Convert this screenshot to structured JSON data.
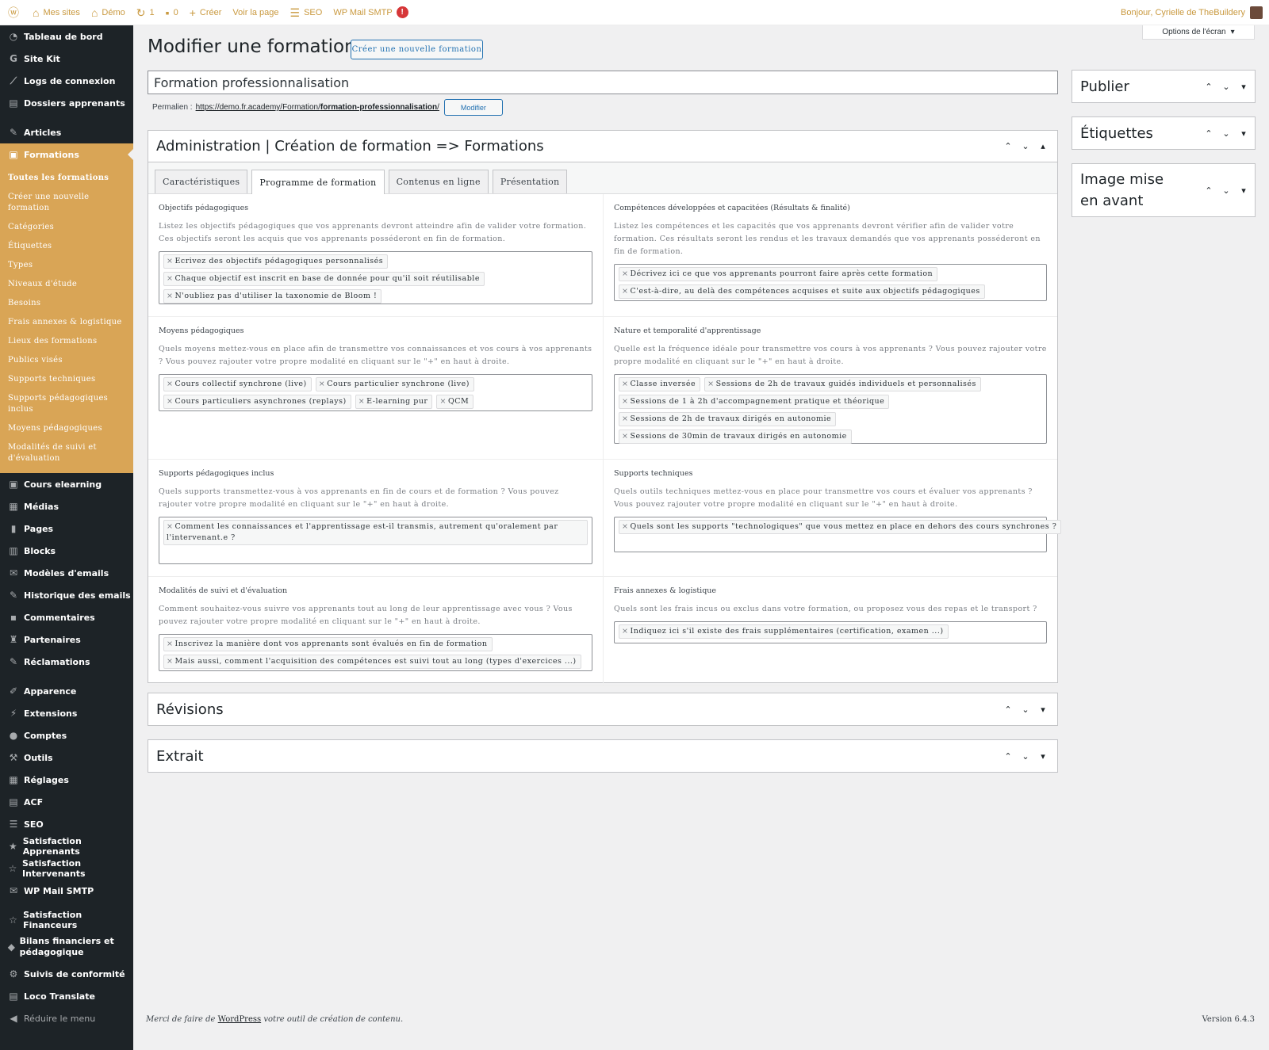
{
  "adminbar": {
    "my_sites": "Mes sites",
    "site_name": "Démo",
    "updates_count": "1",
    "comments_count": "0",
    "new_label": "Créer",
    "view_page": "Voir la page",
    "seo": "SEO",
    "smtp": "WP Mail SMTP",
    "smtp_badge": "!",
    "greeting": "Bonjour, Cyrielle de TheBuildery"
  },
  "sidebar": {
    "top_items": [
      {
        "label": "Tableau de bord",
        "icon": "dashboard-icon"
      },
      {
        "label": "Site Kit",
        "icon": "google-icon"
      },
      {
        "label": "Logs de connexion",
        "icon": "chart-icon"
      },
      {
        "label": "Dossiers apprenants",
        "icon": "folder-icon"
      }
    ],
    "articles": "Articles",
    "formations": "Formations",
    "submenu": [
      "Toutes les formations",
      "Créer une nouvelle formation",
      "Catégories",
      "Étiquettes",
      "Types",
      "Niveaux d'étude",
      "Besoins",
      "Frais annexes & logistique",
      "Lieux des formations",
      "Publics visés",
      "Supports techniques",
      "Supports pédagogiques inclus",
      "Moyens pédagogiques",
      "Modalités de suivi et d'évaluation"
    ],
    "items_after": [
      {
        "label": "Cours elearning",
        "icon": "course-icon"
      },
      {
        "label": "Médias",
        "icon": "media-icon"
      },
      {
        "label": "Pages",
        "icon": "pages-icon"
      },
      {
        "label": "Blocks",
        "icon": "blocks-icon"
      },
      {
        "label": "Modèles d'emails",
        "icon": "email-icon"
      },
      {
        "label": "Historique des emails",
        "icon": "history-icon"
      },
      {
        "label": "Commentaires",
        "icon": "comments-icon"
      },
      {
        "label": "Partenaires",
        "icon": "partners-icon"
      },
      {
        "label": "Réclamations",
        "icon": "claims-icon"
      }
    ],
    "items_admin": [
      {
        "label": "Apparence",
        "icon": "appearance-icon"
      },
      {
        "label": "Extensions",
        "icon": "plugins-icon"
      },
      {
        "label": "Comptes",
        "icon": "users-icon"
      },
      {
        "label": "Outils",
        "icon": "tools-icon"
      },
      {
        "label": "Réglages",
        "icon": "settings-icon"
      },
      {
        "label": "ACF",
        "icon": "acf-icon"
      },
      {
        "label": "SEO",
        "icon": "seo-icon"
      },
      {
        "label": "Satisfaction Apprenants",
        "icon": "star-icon"
      },
      {
        "label": "Satisfaction Intervenants",
        "icon": "star-outline-icon"
      },
      {
        "label": "WP Mail SMTP",
        "icon": "mail-icon"
      }
    ],
    "items_bottom": [
      {
        "label": "Satisfaction Financeurs",
        "icon": "star-outline-icon"
      },
      {
        "label": "Bilans financiers et pédagogique",
        "icon": "tag-icon"
      },
      {
        "label": "Suivis de conformité",
        "icon": "compliance-icon"
      },
      {
        "label": "Loco Translate",
        "icon": "translate-icon"
      }
    ],
    "collapse": "Réduire le menu"
  },
  "page": {
    "screen_options": "Options de l'écran",
    "title": "Modifier une formation",
    "add_new": "Créer une nouvelle formation",
    "post_title": "Formation professionnalisation",
    "permalink_label": "Permalien :",
    "permalink_base": "https://demo.fr.academy/Formation/",
    "permalink_slug": "formation-professionnalisation",
    "permalink_end": "/",
    "permalink_edit": "Modifier"
  },
  "acf": {
    "title": "Administration | Création de formation => Formations",
    "tabs": [
      "Caractéristiques",
      "Programme de formation",
      "Contenus en ligne",
      "Présentation"
    ],
    "fields": [
      {
        "label": "Objectifs pédagogiques",
        "desc": "Listez les objectifs pédagogiques que vos apprenants devront atteindre afin de valider votre formation. Ces objectifs seront les acquis que vos apprenants posséderont en fin de formation.",
        "chips": [
          "Ecrivez des objectifs pédagogiques personnalisés",
          "Chaque objectif est inscrit en base de donnée pour qu'il soit réutilisable",
          "N'oubliez pas d'utiliser la taxonomie de Bloom !"
        ]
      },
      {
        "label": "Compétences développées et capacitées (Résultats & finalité)",
        "desc": "Listez les compétences et les capacités que vos apprenants devront vérifier afin de valider votre formation. Ces résultats seront les rendus et les travaux demandés que vos apprenants posséderont en fin de formation.",
        "chips": [
          "Décrivez ici ce que vos apprenants pourront faire après cette formation",
          "C'est-à-dire, au delà des compétences acquises et suite aux objectifs pédagogiques"
        ]
      },
      {
        "label": "Moyens pédagogiques",
        "desc": "Quels moyens mettez-vous en place afin de transmettre vos connaissances et vos cours à vos apprenants ? Vous pouvez rajouter votre propre modalité en cliquant sur le \"+\" en haut à droite.",
        "chips": [
          "Cours collectif synchrone (live)",
          "Cours particulier synchrone (live)",
          "Cours particuliers asynchrones (replays)",
          "E-learning pur",
          "QCM"
        ]
      },
      {
        "label": "Nature et temporalité d'apprentissage",
        "desc": "Quelle est la fréquence idéale pour transmettre vos cours à vos apprenants ? Vous pouvez rajouter votre propre modalité en cliquant sur le \"+\" en haut à droite.",
        "chips": [
          "Classe inversée",
          "Sessions de 2h de travaux guidés individuels et personnalisés",
          "Sessions de 1 à 2h d'accompagnement pratique et théorique",
          "Sessions de 2h de travaux dirigés en autonomie",
          "Sessions de 30min de travaux dirigés en autonomie"
        ]
      },
      {
        "label": "Supports pédagogiques inclus",
        "desc": "Quels supports transmettez-vous à vos apprenants en fin de cours et de formation ? Vous pouvez rajouter votre propre modalité en cliquant sur le \"+\" en haut à droite.",
        "chips": [
          "Comment les connaissances et l'apprentissage est-il transmis, autrement qu'oralement par l'intervenant.e ?"
        ]
      },
      {
        "label": "Supports techniques",
        "desc": "Quels outils techniques mettez-vous en place pour transmettre vos cours et évaluer vos apprenants ? Vous pouvez rajouter votre propre modalité en cliquant sur le \"+\" en haut à droite.",
        "chips": [
          "Quels sont les supports \"technologiques\" que vous mettez en place en dehors des cours synchrones ?"
        ]
      },
      {
        "label": "Modalités de suivi et d'évaluation",
        "desc": "Comment souhaitez-vous suivre vos apprenants tout au long de leur apprentissage avec vous ? Vous pouvez rajouter votre propre modalité en cliquant sur le \"+\" en haut à droite.",
        "chips": [
          "Inscrivez la manière dont vos apprenants sont évalués en fin de formation",
          "Mais aussi, comment l'acquisition des compétences est suivi tout au long (types d'exercices ...)"
        ]
      },
      {
        "label": "Frais annexes & logistique",
        "desc": "Quels sont les frais incus ou exclus dans votre formation, ou proposez vous des repas et le transport ?",
        "chips": [
          "Indiquez ici s'il existe des frais supplémentaires (certification, examen ...)"
        ]
      }
    ]
  },
  "boxes": {
    "revisions": "Révisions",
    "excerpt": "Extrait",
    "publish": "Publier",
    "tags": "Étiquettes",
    "featured": "Image mise en avant"
  },
  "footer": {
    "thanks_pre": "Merci de faire de ",
    "thanks_link": "WordPress",
    "thanks_post": " votre outil de création de contenu.",
    "version": "Version 6.4.3"
  },
  "colors": {
    "accent": "#d9a556",
    "sidebar": "#1d2327",
    "link": "#2271b1"
  }
}
